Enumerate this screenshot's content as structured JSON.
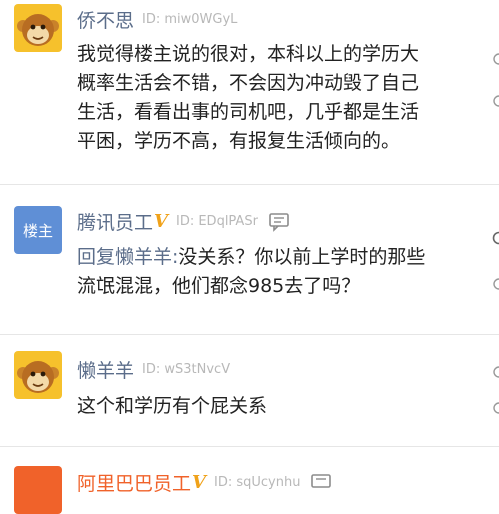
{
  "comments": [
    {
      "username": "侨不思",
      "uid": "ID: miw0WGyL",
      "text_lines": [
        "我觉得楼主说的很对，本科以上的学历大",
        "概率生活会不错，不会因为冲动毁了自己",
        "生活，看看出事的司机吧，几乎都是生活",
        "平困，学历不高，有报复生活倾向的。"
      ]
    },
    {
      "avatar_label": "楼主",
      "username": "腾讯员工",
      "badge": "V",
      "uid": "ID: EDqlPASr",
      "reply_prefix": "回复懒羊羊:",
      "text_first": "没关系？你以前上学时的那些",
      "text_second": "流氓混混，他们都念985去了吗？"
    },
    {
      "username": "懒羊羊",
      "uid": "ID: wS3tNvcV",
      "text": "这个和学历有个屁关系"
    },
    {
      "username": "阿里巴巴员工",
      "badge": "V",
      "uid": "ID: sqUcynhu"
    }
  ],
  "colors": {
    "username": "#5b6d8a",
    "badge": "#f0a21a",
    "orange": "#f0622a",
    "owner": "#5f8fd6"
  }
}
